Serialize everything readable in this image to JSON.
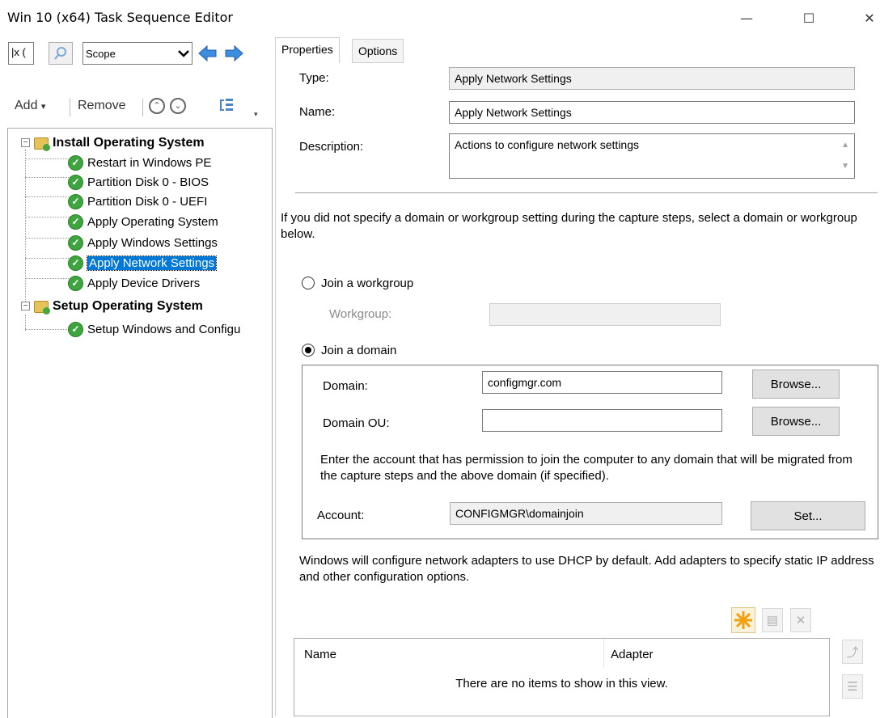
{
  "window": {
    "title": "Win 10 (x64) Task Sequence Editor",
    "minimize_glyph": "—",
    "maximize_glyph": "☐",
    "close_glyph": "✕"
  },
  "left": {
    "search_value": "|x (",
    "scope_label": "Scope",
    "commands": {
      "add": "Add",
      "remove": "Remove"
    },
    "tree": {
      "groups": [
        {
          "label": "Install Operating System",
          "expander": "−",
          "items": [
            "Restart in Windows PE",
            "Partition Disk 0 - BIOS",
            "Partition Disk 0 - UEFI",
            "Apply Operating System",
            "Apply Windows Settings",
            "Apply Network Settings",
            "Apply Device Drivers"
          ]
        },
        {
          "label": "Setup Operating System",
          "expander": "−",
          "items": [
            "Setup Windows and Configu"
          ]
        }
      ],
      "selected_item": "Apply Network Settings"
    }
  },
  "tabs": [
    {
      "label": "Properties",
      "active": true
    },
    {
      "label": "Options",
      "active": false
    }
  ],
  "properties": {
    "type_label": "Type:",
    "type_value": "Apply Network Settings",
    "name_label": "Name:",
    "name_value": "Apply Network Settings",
    "description_label": "Description:",
    "description_value": "Actions to configure network settings",
    "intro_text": "If you did not specify a domain or workgroup setting during the capture steps, select a domain or workgroup below.",
    "workgroup_option": "Join a workgroup",
    "workgroup_label": "Workgroup:",
    "workgroup_value": "",
    "domain_option": "Join a domain",
    "domain_selected": true,
    "domain_label": "Domain:",
    "domain_value": "configmgr.com",
    "browse_label": "Browse...",
    "domain_ou_label": "Domain OU:",
    "domain_ou_value": "",
    "account_help": "Enter the account that has permission to join the computer to any domain that will be migrated from the capture steps and the above domain (if specified).",
    "account_label": "Account:",
    "account_value": "CONFIGMGR\\domainjoin",
    "set_label": "Set...",
    "adapters_text": "Windows will configure network adapters to use DHCP by default. Add adapters to specify static IP address and other configuration options.",
    "list_columns": [
      "Name",
      "Adapter"
    ],
    "empty_text": "There are no items to show in this view."
  }
}
